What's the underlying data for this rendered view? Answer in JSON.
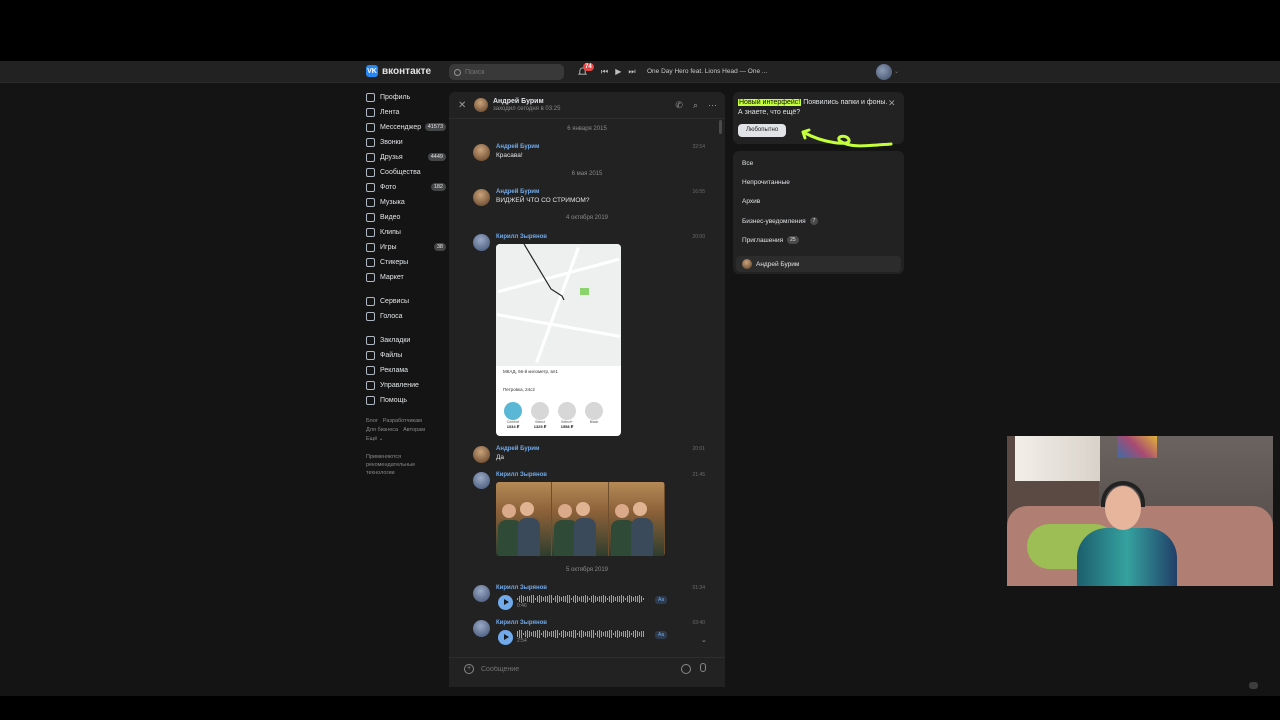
{
  "header": {
    "logo_text": "вконтакте",
    "logo_badge": "VK",
    "search_placeholder": "Поиск",
    "notifications_count": "74",
    "track": "One Day Hero feat. Lions Head — One ..."
  },
  "sidebar": {
    "items": [
      {
        "label": "Профиль",
        "count": ""
      },
      {
        "label": "Лента",
        "count": ""
      },
      {
        "label": "Мессенджер",
        "count": "41573"
      },
      {
        "label": "Звонки",
        "count": ""
      },
      {
        "label": "Друзья",
        "count": "4449"
      },
      {
        "label": "Сообщества",
        "count": ""
      },
      {
        "label": "Фото",
        "count": "182"
      },
      {
        "label": "Музыка",
        "count": ""
      },
      {
        "label": "Видео",
        "count": ""
      },
      {
        "label": "Клипы",
        "count": ""
      },
      {
        "label": "Игры",
        "count": "38"
      },
      {
        "label": "Стикеры",
        "count": ""
      },
      {
        "label": "Маркет",
        "count": ""
      }
    ],
    "items2": [
      {
        "label": "Сервисы"
      },
      {
        "label": "Голоса"
      }
    ],
    "items3": [
      {
        "label": "Закладки"
      },
      {
        "label": "Файлы"
      },
      {
        "label": "Реклама"
      },
      {
        "label": "Управление"
      },
      {
        "label": "Помощь"
      }
    ],
    "footer_links": [
      "Блог",
      "Разработчикам",
      "Для бизнеса",
      "Авторам",
      "Ещё ⌄"
    ],
    "footer_note": "Применяются рекомендательные технологии"
  },
  "chat": {
    "contact_name": "Андрей Бурим",
    "contact_status": "заходил сегодня в 03:25",
    "dates": [
      "6 января 2015",
      "6 мая 2015",
      "4 октября 2019",
      "5 октября 2019"
    ],
    "messages": [
      {
        "author": "Андрей Бурим",
        "text": "Красава!",
        "time": "22:54"
      },
      {
        "author": "Андрей Бурим",
        "text": "ВИДЖЕЙ ЧТО СО СТРИМОМ?",
        "time": "16:55"
      },
      {
        "author": "Кирилл Зырянов",
        "text": "",
        "time": "20:00"
      },
      {
        "author": "Андрей Бурим",
        "text": "Да",
        "time": "20:01"
      },
      {
        "author": "Кирилл Зырянов",
        "text": "",
        "time": "21:45"
      },
      {
        "author": "Кирилл Зырянов",
        "text": "",
        "time": "01:34",
        "duration": "0:46"
      },
      {
        "author": "Кирилл Зырянов",
        "text": "",
        "time": "03:40",
        "duration": "2:54"
      }
    ],
    "map_card": {
      "address1": "МКАД, 66-й километр, вл1",
      "address2": "Петровка, 24с2",
      "taxis": [
        {
          "name": "Comfort",
          "price": "1034 ₽"
        },
        {
          "name": "Select",
          "price": "1325 ₽"
        },
        {
          "name": "Select+",
          "price": "1558 ₽"
        },
        {
          "name": "Black",
          "price": ""
        }
      ]
    },
    "voice_transcribe_label": "Аа",
    "composer_placeholder": "Сообщение"
  },
  "promo": {
    "highlight": "Новый интерфейс!",
    "text": " Появились папки и фоны. А знаете, что ещё?",
    "button": "Любопытно"
  },
  "folders": {
    "items": [
      {
        "label": "Все",
        "badge": ""
      },
      {
        "label": "Непрочитанные",
        "badge": ""
      },
      {
        "label": "Архив",
        "badge": ""
      },
      {
        "label": "Бизнес-уведомления",
        "badge": "7"
      },
      {
        "label": "Приглашения",
        "badge": "25"
      }
    ],
    "active_chat": "Андрей Бурим"
  }
}
